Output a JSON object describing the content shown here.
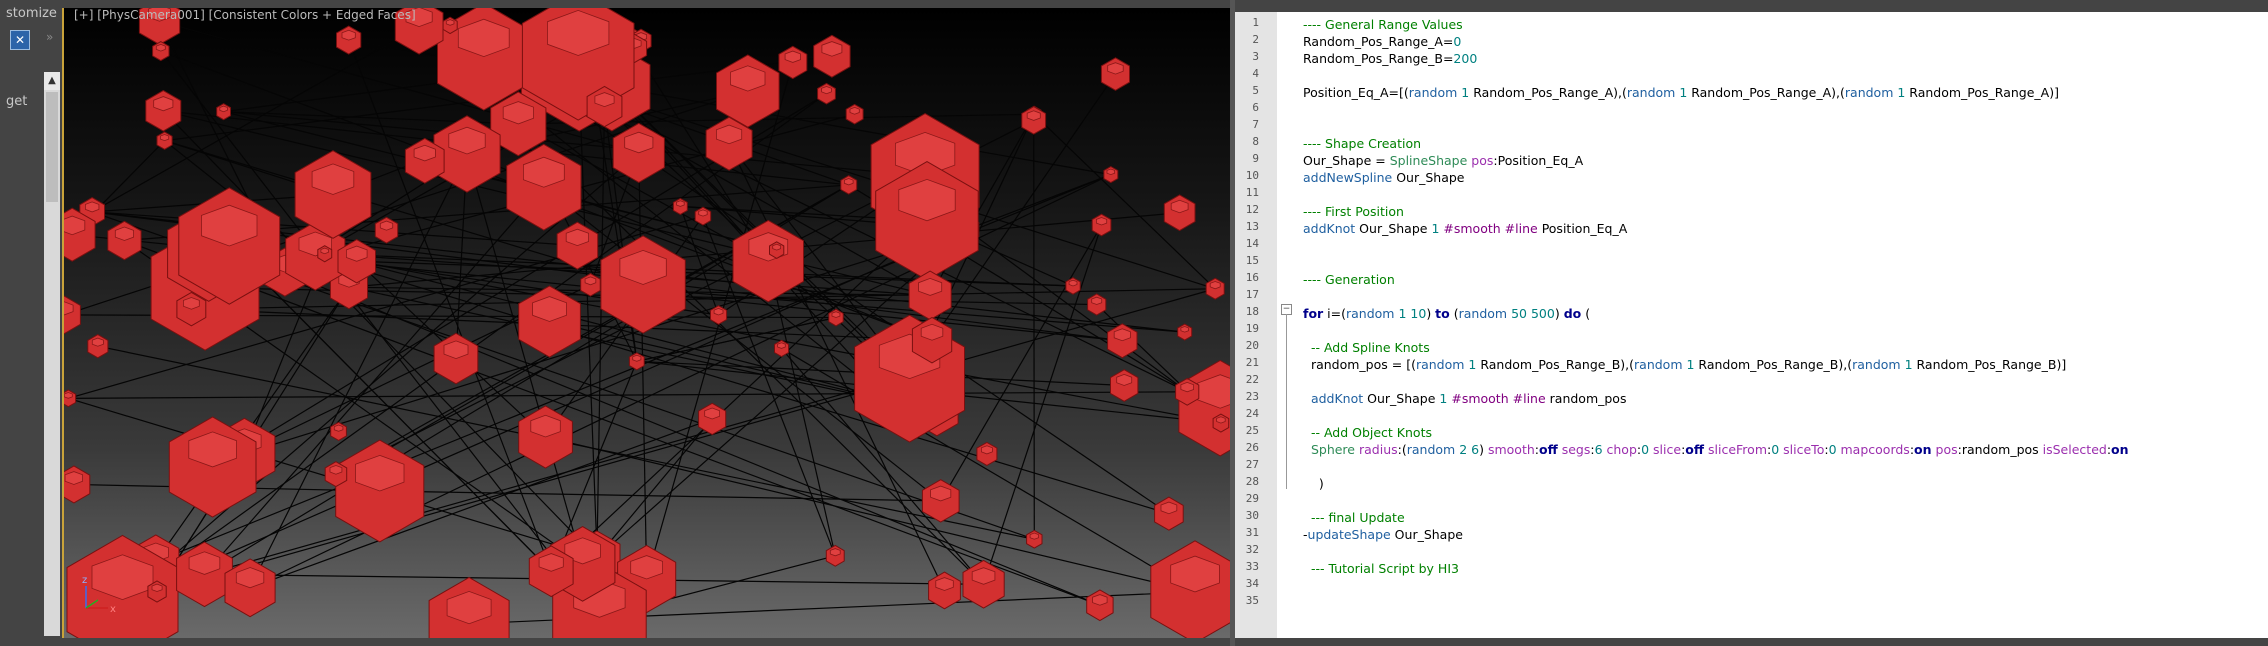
{
  "left_panel": {
    "title": "stomize",
    "label_1": "get",
    "label_2": "",
    "scroll_up_glyph": "▲"
  },
  "viewport": {
    "label": "[+] [PhysCamera001] [Consistent Colors + Edged Faces]",
    "axis_x": "x",
    "axis_z": "z"
  },
  "editor": {
    "line_numbers": [
      "1",
      "2",
      "3",
      "4",
      "5",
      "6",
      "7",
      "8",
      "9",
      "10",
      "11",
      "12",
      "13",
      "14",
      "15",
      "16",
      "17",
      "18",
      "19",
      "20",
      "21",
      "22",
      "23",
      "24",
      "25",
      "26",
      "27",
      "28",
      "29",
      "30",
      "31",
      "32",
      "33",
      "34",
      "35"
    ],
    "fold_glyph": "−",
    "lines": [
      [
        [
          "c-comment",
          "---- General Range Values"
        ]
      ],
      [
        [
          "",
          "Random_Pos_Range_A="
        ],
        [
          "c-num",
          "0"
        ]
      ],
      [
        [
          "",
          "Random_Pos_Range_B="
        ],
        [
          "c-num",
          "200"
        ]
      ],
      [],
      [
        [
          "",
          "Position_Eq_A=["
        ],
        [
          "",
          "("
        ],
        [
          "c-func",
          "random"
        ],
        [
          "",
          " "
        ],
        [
          "c-num",
          "1"
        ],
        [
          "",
          " Random_Pos_Range_A),("
        ],
        [
          "c-func",
          "random"
        ],
        [
          "",
          " "
        ],
        [
          "c-num",
          "1"
        ],
        [
          "",
          " Random_Pos_Range_A),("
        ],
        [
          "c-func",
          "random"
        ],
        [
          "",
          " "
        ],
        [
          "c-num",
          "1"
        ],
        [
          "",
          " Random_Pos_Range_A)]"
        ]
      ],
      [],
      [],
      [
        [
          "c-comment",
          "---- Shape Creation"
        ]
      ],
      [
        [
          "",
          "Our_Shape = "
        ],
        [
          "c-class",
          "SplineShape"
        ],
        [
          "",
          " "
        ],
        [
          "c-param",
          "pos"
        ],
        [
          "",
          ":Position_Eq_A"
        ]
      ],
      [
        [
          "c-func",
          "addNewSpline"
        ],
        [
          "",
          " Our_Shape"
        ]
      ],
      [],
      [
        [
          "c-comment",
          "---- First Position"
        ]
      ],
      [
        [
          "c-func",
          "addKnot"
        ],
        [
          "",
          " Our_Shape "
        ],
        [
          "c-num",
          "1"
        ],
        [
          "",
          " "
        ],
        [
          "c-name",
          "#smooth"
        ],
        [
          "",
          " "
        ],
        [
          "c-name",
          "#line"
        ],
        [
          "",
          " Position_Eq_A"
        ]
      ],
      [],
      [],
      [
        [
          "c-comment",
          "---- Generation"
        ]
      ],
      [],
      [
        [
          "c-keyword",
          "for"
        ],
        [
          "",
          " i=("
        ],
        [
          "c-func",
          "random"
        ],
        [
          "",
          " "
        ],
        [
          "c-num",
          "1"
        ],
        [
          "",
          " "
        ],
        [
          "c-num",
          "10"
        ],
        [
          "",
          ") "
        ],
        [
          "c-keyword",
          "to"
        ],
        [
          "",
          " ("
        ],
        [
          "c-func",
          "random"
        ],
        [
          "",
          " "
        ],
        [
          "c-num",
          "50"
        ],
        [
          "",
          " "
        ],
        [
          "c-num",
          "500"
        ],
        [
          "",
          ") "
        ],
        [
          "c-keyword",
          "do"
        ],
        [
          "",
          " ("
        ]
      ],
      [],
      [
        [
          "",
          "  "
        ],
        [
          "c-comment",
          "-- Add Spline Knots"
        ]
      ],
      [
        [
          "",
          "  random_pos = [("
        ],
        [
          "c-func",
          "random"
        ],
        [
          "",
          " "
        ],
        [
          "c-num",
          "1"
        ],
        [
          "",
          " Random_Pos_Range_B),("
        ],
        [
          "c-func",
          "random"
        ],
        [
          "",
          " "
        ],
        [
          "c-num",
          "1"
        ],
        [
          "",
          " Random_Pos_Range_B),("
        ],
        [
          "c-func",
          "random"
        ],
        [
          "",
          " "
        ],
        [
          "c-num",
          "1"
        ],
        [
          "",
          " Random_Pos_Range_B)]"
        ]
      ],
      [],
      [
        [
          "",
          "  "
        ],
        [
          "c-func",
          "addKnot"
        ],
        [
          "",
          " Our_Shape "
        ],
        [
          "c-num",
          "1"
        ],
        [
          "",
          " "
        ],
        [
          "c-name",
          "#smooth"
        ],
        [
          "",
          " "
        ],
        [
          "c-name",
          "#line"
        ],
        [
          "",
          " random_pos"
        ]
      ],
      [],
      [
        [
          "",
          "  "
        ],
        [
          "c-comment",
          "-- Add Object Knots"
        ]
      ],
      [
        [
          "",
          "  "
        ],
        [
          "c-class",
          "Sphere"
        ],
        [
          "",
          " "
        ],
        [
          "c-param",
          "radius"
        ],
        [
          "",
          ":("
        ],
        [
          "c-func",
          "random"
        ],
        [
          "",
          " "
        ],
        [
          "c-num",
          "2"
        ],
        [
          "",
          " "
        ],
        [
          "c-num",
          "6"
        ],
        [
          "",
          ") "
        ],
        [
          "c-param",
          "smooth"
        ],
        [
          "",
          ":"
        ],
        [
          "c-keyword",
          "off"
        ],
        [
          "",
          " "
        ],
        [
          "c-param",
          "segs"
        ],
        [
          "",
          ":"
        ],
        [
          "c-num",
          "6"
        ],
        [
          "",
          " "
        ],
        [
          "c-param",
          "chop"
        ],
        [
          "",
          ":"
        ],
        [
          "c-num",
          "0"
        ],
        [
          "",
          " "
        ],
        [
          "c-param",
          "slice"
        ],
        [
          "",
          ":"
        ],
        [
          "c-keyword",
          "off"
        ],
        [
          "",
          " "
        ],
        [
          "c-param",
          "sliceFrom"
        ],
        [
          "",
          ":"
        ],
        [
          "c-num",
          "0"
        ],
        [
          "",
          " "
        ],
        [
          "c-param",
          "sliceTo"
        ],
        [
          "",
          ":"
        ],
        [
          "c-num",
          "0"
        ],
        [
          "",
          " "
        ],
        [
          "c-param",
          "mapcoords"
        ],
        [
          "",
          ":"
        ],
        [
          "c-keyword",
          "on"
        ],
        [
          "",
          " "
        ],
        [
          "c-param",
          "pos"
        ],
        [
          "",
          ":random_pos "
        ],
        [
          "c-param",
          "isSelected"
        ],
        [
          "",
          ":"
        ],
        [
          "c-keyword",
          "on"
        ]
      ],
      [],
      [
        [
          "",
          "    )"
        ]
      ],
      [],
      [
        [
          "",
          "  "
        ],
        [
          "c-comment",
          "--- final Update"
        ]
      ],
      [
        [
          "",
          "-"
        ],
        [
          "c-func",
          "updateShape"
        ],
        [
          "",
          " Our_Shape"
        ]
      ],
      [],
      [
        [
          "",
          "  "
        ],
        [
          "c-comment",
          "--- Tutorial Script by HI3"
        ]
      ],
      [],
      []
    ]
  }
}
